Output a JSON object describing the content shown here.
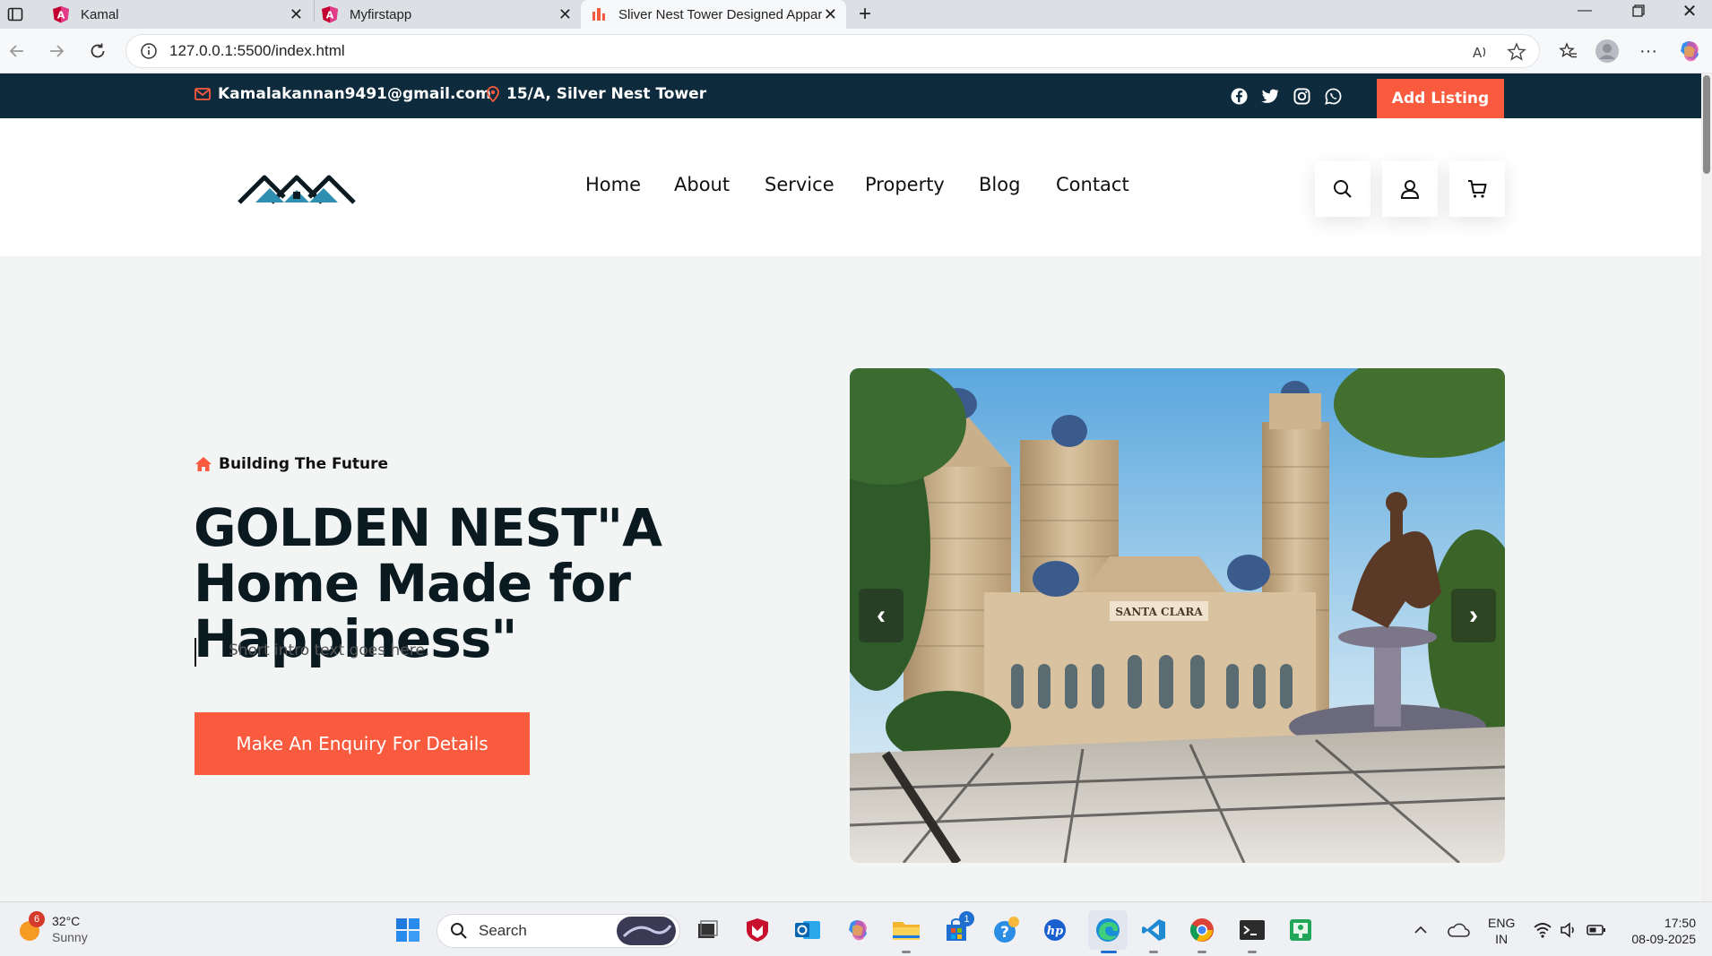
{
  "browser": {
    "tabs": [
      {
        "title": "Kamal"
      },
      {
        "title": "Myfirstapp"
      },
      {
        "title": "Sliver Nest Tower Designed Appar"
      }
    ],
    "url": "127.0.0.1:5500/index.html"
  },
  "topbar": {
    "email": "Kamalakannan9491@gmail.com",
    "address": "15/A, Silver Nest Tower",
    "add_listing": "Add Listing"
  },
  "nav": {
    "items": [
      "Home",
      "About",
      "Service",
      "Property",
      "Blog",
      "Contact"
    ]
  },
  "hero": {
    "tagline": "Building The Future",
    "title": "GOLDEN NEST\"A Home Made for Happiness\"",
    "intro": "Short intro text goes here.",
    "cta": "Make An Enquiry For Details",
    "image_sign": "SANTA CLARA",
    "prev": "‹",
    "next": "›"
  },
  "taskbar": {
    "weather_temp": "32°C",
    "weather_text": "Sunny",
    "weather_badge": "6",
    "search": "Search",
    "store_badge": "1",
    "lang": "ENG",
    "region": "IN",
    "time": "17:50",
    "date": "08-09-2025"
  },
  "colors": {
    "accent": "#fa5a3d",
    "topbar": "#0d2b3c",
    "title": "#0b1a21"
  }
}
